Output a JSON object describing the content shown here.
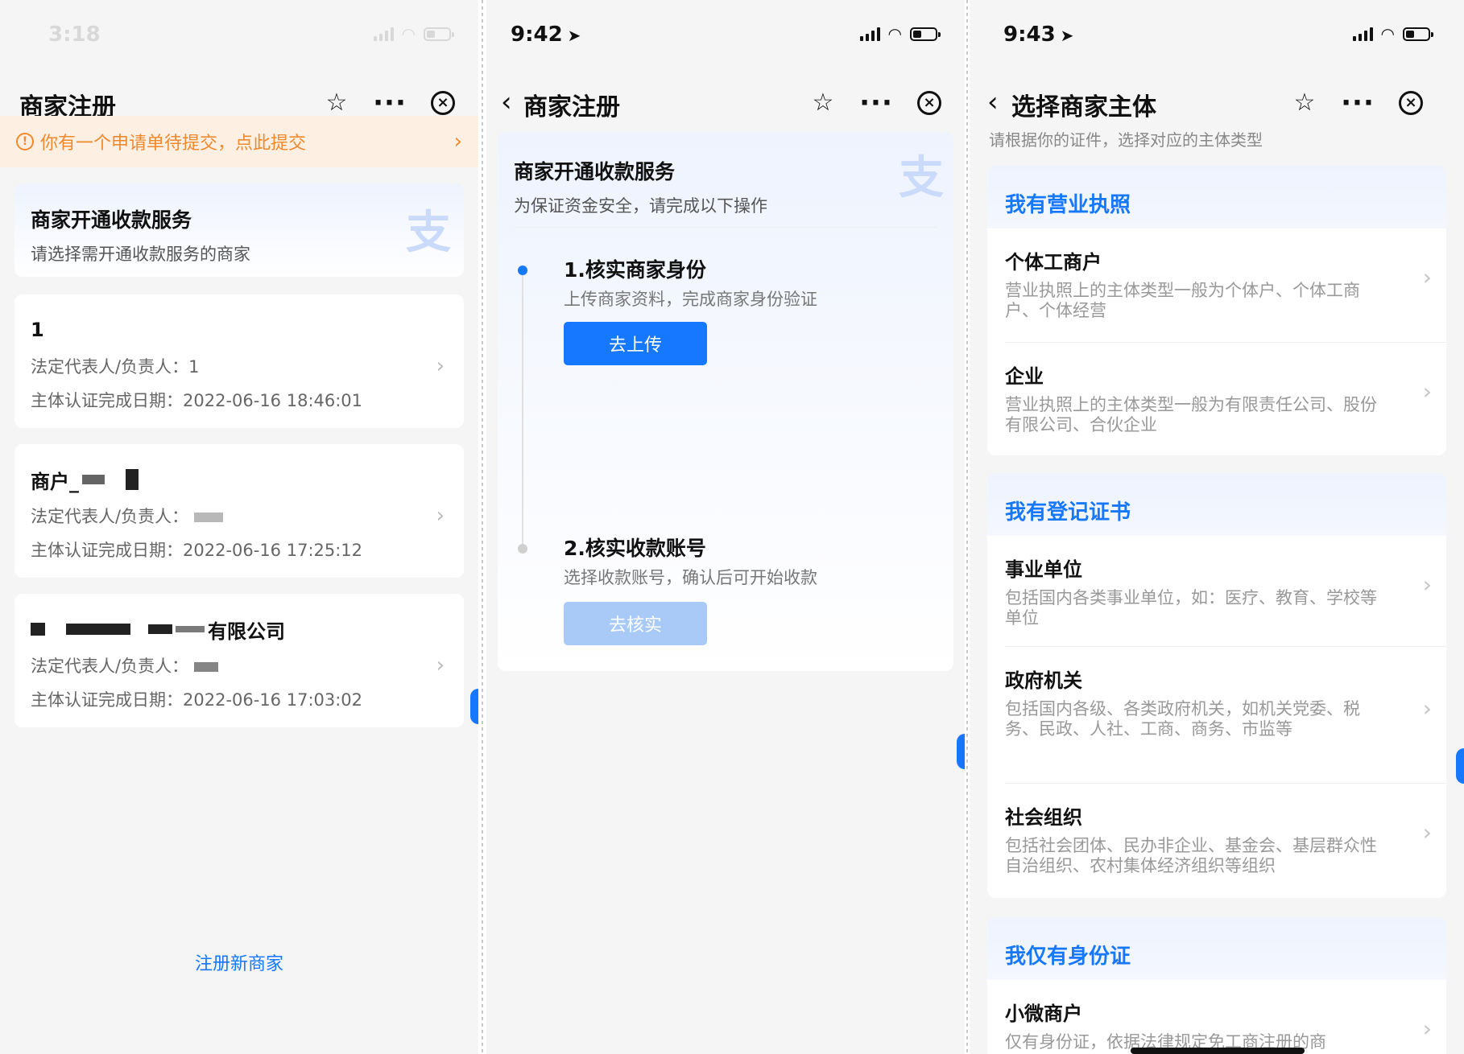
{
  "colors": {
    "accent": "#1677ff",
    "notice": "#f0892e",
    "muted_button": "#a9caf6"
  },
  "p1": {
    "status_time": "3:18",
    "nav_title": "商家注册",
    "notice": "你有一个申请单待提交，点此提交",
    "hero": {
      "title": "商家开通收款服务",
      "subtitle": "请选择需开通收款服务的商家"
    },
    "merchants": [
      {
        "name": "1",
        "rep": "法定代表人/负责人：1",
        "date": "主体认证完成日期：2022-06-16 18:46:01"
      },
      {
        "name": "商户_",
        "rep": "法定代表人/负责人：",
        "date": "主体认证完成日期：2022-06-16 17:25:12"
      },
      {
        "name": "有限公司",
        "rep": "法定代表人/负责人：",
        "date": "主体认证完成日期：2022-06-16 17:03:02"
      }
    ],
    "register_link": "注册新商家"
  },
  "p2": {
    "status_time": "9:42",
    "nav_title": "商家注册",
    "hero": {
      "title": "商家开通收款服务",
      "subtitle": "为保证资金安全，请完成以下操作"
    },
    "steps": [
      {
        "title": "1.核实商家身份",
        "subtitle": "上传商家资料，完成商家身份验证",
        "button": "去上传",
        "active": true
      },
      {
        "title": "2.核实收款账号",
        "subtitle": "选择收款账号，确认后可开始收款",
        "button": "去核实",
        "active": false
      }
    ]
  },
  "p3": {
    "status_time": "9:43",
    "nav_title": "选择商家主体",
    "hint": "请根据你的证件，选择对应的主体类型",
    "sections": [
      {
        "heading": "我有营业执照",
        "items": [
          {
            "title": "个体工商户",
            "desc": "营业执照上的主体类型一般为个体户、个体工商户、个体经营"
          },
          {
            "title": "企业",
            "desc": "营业执照上的主体类型一般为有限责任公司、股份有限公司、合伙企业"
          }
        ]
      },
      {
        "heading": "我有登记证书",
        "items": [
          {
            "title": "事业单位",
            "desc": "包括国内各类事业单位，如：医疗、教育、学校等单位"
          },
          {
            "title": "政府机关",
            "desc": "包括国内各级、各类政府机关，如机关党委、税务、民政、人社、工商、商务、市监等"
          },
          {
            "title": "社会组织",
            "desc": "包括社会团体、民办非企业、基金会、基层群众性自治组织、农村集体经济组织等组织"
          }
        ]
      },
      {
        "heading": "我仅有身份证",
        "items": [
          {
            "title": "小微商户",
            "desc": "仅有身份证，依据法律规定免工商注册的商"
          }
        ]
      }
    ]
  }
}
